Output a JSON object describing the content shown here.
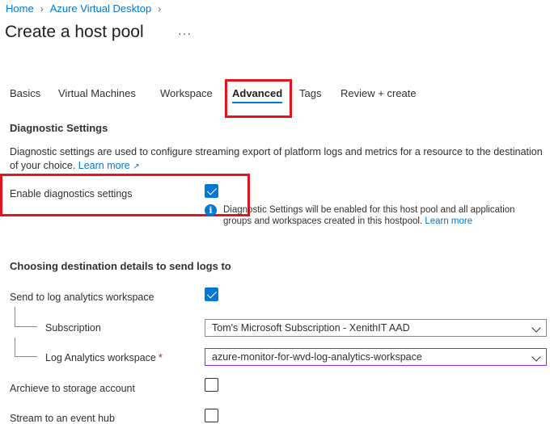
{
  "breadcrumb": {
    "items": [
      "Home",
      "Azure Virtual Desktop"
    ]
  },
  "page": {
    "title": "Create a host pool",
    "more": "···"
  },
  "tabs": [
    "Basics",
    "Virtual Machines",
    "Workspace",
    "Advanced",
    "Tags",
    "Review + create"
  ],
  "active_tab": "Advanced",
  "diagnostic": {
    "heading": "Diagnostic Settings",
    "description": "Diagnostic settings are used to configure streaming export of platform logs and metrics for a resource to the destination of your choice.",
    "learn_more": "Learn more",
    "enable_label": "Enable diagnostics settings",
    "enable_checked": true,
    "info_text": "Diagnostic Settings will be enabled for this host pool and all application groups and workspaces created in this hostpool.",
    "info_learn_more": "Learn more"
  },
  "destination": {
    "heading": "Choosing destination details to send logs to",
    "log_analytics_label": "Send to log analytics workspace",
    "log_analytics_checked": true,
    "subscription_label": "Subscription",
    "subscription_value": "Tom's Microsoft Subscription - XenithIT AAD",
    "workspace_label": "Log Analytics workspace",
    "workspace_required": "*",
    "workspace_value": "azure-monitor-for-wvd-log-analytics-workspace",
    "storage_label": "Archieve to storage account",
    "storage_checked": false,
    "event_hub_label": "Stream to an event hub",
    "event_hub_checked": false
  },
  "colors": {
    "accent": "#0078d4",
    "highlight": "#e3141f",
    "text": "#323130"
  }
}
